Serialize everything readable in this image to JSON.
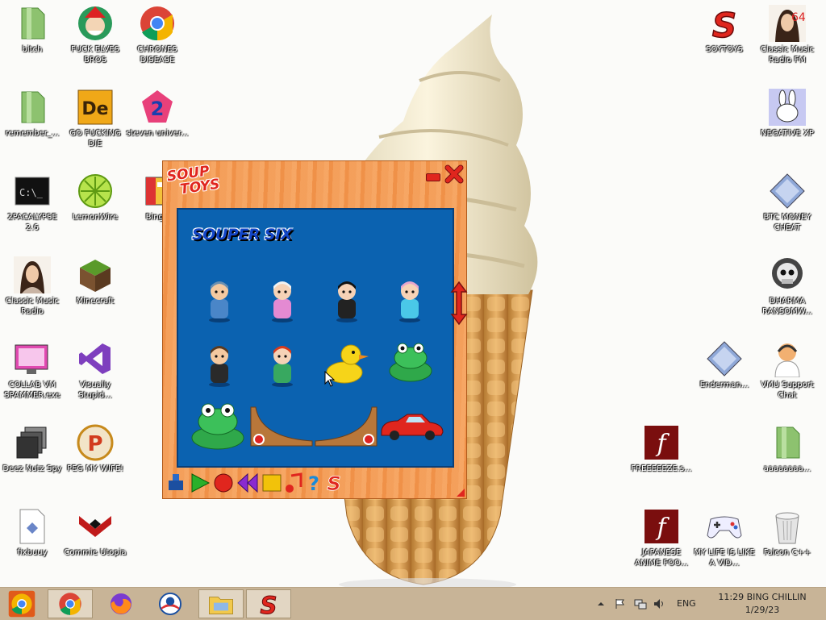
{
  "desktop": {
    "icons_left": [
      {
        "name": "bitch-icon",
        "label": "bitch",
        "type": "file"
      },
      {
        "name": "fuck-elves-bros-icon",
        "label": "FUCK ELVES BROS",
        "type": "elf"
      },
      {
        "name": "chrones-disease-icon",
        "label": "CHRONES DISEASE",
        "type": "chrome"
      },
      {
        "name": "remember-icon",
        "label": "remember_...",
        "type": "file"
      },
      {
        "name": "go-fucking-die-icon",
        "label": "GO FUCKING DIE",
        "type": "de"
      },
      {
        "name": "steven-universe-icon",
        "label": "steven univer...",
        "type": "steven"
      },
      {
        "name": "2pacalypse-icon",
        "label": "2PACALYPSE 2.6",
        "type": "cmd"
      },
      {
        "name": "lemonwire-icon",
        "label": "LemonWire",
        "type": "lemon"
      },
      {
        "name": "bing-chilling-icon",
        "label": "Bing Ch",
        "type": "bing"
      },
      {
        "name": "classic-music-radio-icon",
        "label": "Classic Music Radio",
        "type": "portrait"
      },
      {
        "name": "minecraft-icon",
        "label": "Minecraft",
        "type": "minecraft"
      },
      {
        "name": "collab-vm-spammer-icon",
        "label": "COLLAB VM SPAMMER.exe",
        "type": "monitor"
      },
      {
        "name": "visually-stupid-icon",
        "label": "Visually Stupid...",
        "type": "vs"
      },
      {
        "name": "deez-nutz-spy-icon",
        "label": "Deez Nutz Spy",
        "type": "stack"
      },
      {
        "name": "peg-my-wife-icon",
        "label": "PEG MY WIFE!",
        "type": "peg"
      },
      {
        "name": "fixbuuy-icon",
        "label": "fixbuuy",
        "type": "doc"
      },
      {
        "name": "commie-utopia-icon",
        "label": "Commie Utopia",
        "type": "commie"
      }
    ],
    "icons_right": [
      {
        "name": "soytoys-icon",
        "label": "SOYTOYS",
        "type": "soup"
      },
      {
        "name": "classic-music-radio-fm-icon",
        "label": "Classic Music Radio FM",
        "type": "portrait64"
      },
      {
        "name": "negative-xp-icon",
        "label": "NEGATIVE XP",
        "type": "bunny"
      },
      {
        "name": "btc-money-cheat-icon",
        "label": "BTC MONEY CHEAT",
        "type": "diamond"
      },
      {
        "name": "dharma-ransomware-icon",
        "label": "DHARMA RANSOMW...",
        "type": "skull"
      },
      {
        "name": "enderman-icon",
        "label": "Enderman...",
        "type": "diamond"
      },
      {
        "name": "vmu-support-chat-icon",
        "label": "VMU Support Chat",
        "type": "support"
      },
      {
        "name": "freeeeeze-icon",
        "label": "FREEEEEZE.s...",
        "type": "flash"
      },
      {
        "name": "aaaaaaaa-icon",
        "label": "aaaaaaaa...",
        "type": "file"
      },
      {
        "name": "japanese-anime-icon",
        "label": "JAPANESE ANIME FOO...",
        "type": "flash"
      },
      {
        "name": "my-life-is-like-a-video-icon",
        "label": "MY LIFE IS LIKE A VID...",
        "type": "gamepad"
      },
      {
        "name": "falcon-cpp-icon",
        "label": "Falcon C++",
        "type": "trash"
      }
    ]
  },
  "soup_window": {
    "logo_line1": "SOUP",
    "logo_line2": "TOYS",
    "heading": "SOUPER SIX",
    "toys": [
      "doll-man-1",
      "doll-girl-1",
      "doll-girl-2",
      "doll-girl-3",
      "doll-man-2",
      "doll-girl-4",
      "rubber-duck",
      "frog-small",
      "frog-large",
      "ramp-left",
      "ramp-right",
      "red-car"
    ],
    "toolbar": [
      "stamp-icon",
      "play-icon",
      "record-icon",
      "rewind-icon",
      "stop-icon",
      "music-icon",
      "help-icon",
      "soup-icon"
    ]
  },
  "taskbar": {
    "buttons": [
      "chrome-beta-icon",
      "chrome-icon",
      "firefox-icon",
      "obama-icon",
      "file-explorer-icon",
      "soup-toys-taskbar-icon"
    ],
    "lang": "ENG",
    "time": "11:29 BING CHILLIN",
    "date": "1/29/23"
  },
  "colors": {
    "taskbar_bg": "#c8b497",
    "soup_orange": "#f39a55",
    "soup_blue": "#0b62b0",
    "soup_red": "#e0261e"
  }
}
